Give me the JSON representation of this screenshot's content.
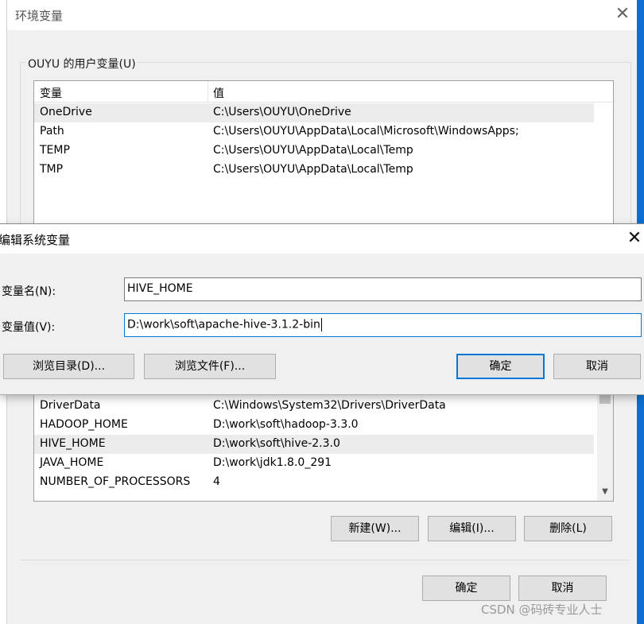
{
  "env_window": {
    "title": "环境变量",
    "close_glyph": "✕",
    "user_group_label": "OUYU 的用户变量(U)",
    "user_columns": [
      "变量",
      "值"
    ],
    "user_rows": [
      {
        "name": "OneDrive",
        "value": "C:\\Users\\OUYU\\OneDrive",
        "selected": true
      },
      {
        "name": "Path",
        "value": "C:\\Users\\OUYU\\AppData\\Local\\Microsoft\\WindowsApps;",
        "selected": false
      },
      {
        "name": "TEMP",
        "value": "C:\\Users\\OUYU\\AppData\\Local\\Temp",
        "selected": false
      },
      {
        "name": "TMP",
        "value": "C:\\Users\\OUYU\\AppData\\Local\\Temp",
        "selected": false
      }
    ],
    "system_rows": [
      {
        "name": "DriverData",
        "value": "C:\\Windows\\System32\\Drivers\\DriverData",
        "selected": false
      },
      {
        "name": "HADOOP_HOME",
        "value": "D:\\work\\soft\\hadoop-3.3.0",
        "selected": false
      },
      {
        "name": "HIVE_HOME",
        "value": "D:\\work\\soft\\hive-2.3.0",
        "selected": true
      },
      {
        "name": "JAVA_HOME",
        "value": "D:\\work\\jdk1.8.0_291",
        "selected": false
      },
      {
        "name": "NUMBER_OF_PROCESSORS",
        "value": "4",
        "selected": false
      }
    ],
    "system_buttons": {
      "new": "新建(W)...",
      "edit": "编辑(I)...",
      "delete": "删除(L)"
    },
    "ok": "确定",
    "cancel": "取消"
  },
  "edit_dialog": {
    "title": "编辑系统变量",
    "close_glyph": "✕",
    "name_label": "变量名(N):",
    "value_label": "变量值(V):",
    "name_value": "HIVE_HOME",
    "value_value": "D:\\work\\soft\\apache-hive-3.1.2-bin",
    "browse_dir": "浏览目录(D)...",
    "browse_file": "浏览文件(F)...",
    "ok": "确定",
    "cancel": "取消"
  },
  "watermark": "CSDN @码砖专业人士",
  "colors": {
    "accent": "#0078d7",
    "desktop": "#0a6fd6"
  }
}
